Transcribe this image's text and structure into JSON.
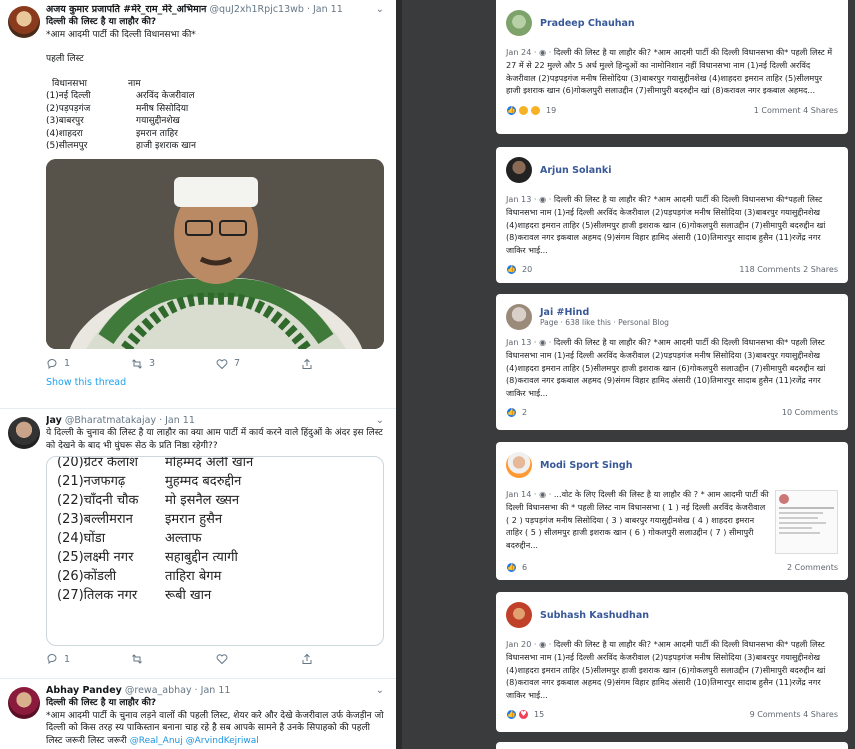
{
  "colors": {
    "twitter_blue": "#1da1f2",
    "fb_link": "#385898",
    "bg": "#3a3b3c"
  },
  "tweets": [
    {
      "name": "अजय कुमार प्रजापति #मेरे_राम_मेरे_अभिमान",
      "handle": "@quJ2xh1Rpjc13wb · Jan 11",
      "title": "दिल्ली की लिस्ट है या लाहौर की?",
      "subtitle": "*आम आदमी पार्टी की दिल्ली विधानसभा की*",
      "list_heading": "पहली लिस्ट",
      "col1_header": "विधानसभा",
      "col2_header": "नाम",
      "rows": [
        {
          "seat": "(1)नई दिल्ली",
          "name": "अरविंद केजरीवाल"
        },
        {
          "seat": "(2)पड़पड़गंज",
          "name": "मनीष सिसोदिया"
        },
        {
          "seat": "(3)बाबरपुर",
          "name": "गयासुद्दीनशेख"
        },
        {
          "seat": "(4)शाहदरा",
          "name": "इमरान ताहिर"
        },
        {
          "seat": "(5)सीलमपुर",
          "name": "हाजी इशराक खान"
        }
      ],
      "replies": "1",
      "retweets": "3",
      "likes": "7",
      "show_thread": "Show this thread"
    },
    {
      "name": "Jay",
      "handle": "@Bharatmatakajay · Jan 11",
      "text": "ये दिल्ली के चुनाव की लिस्ट है या लाहौर का क्या आम पार्टी में कार्य करने वाले हिंदुओं के अंदर इस लिस्ट को देखने के बाद भी घुंघरू सेठ के प्रति निष्ठा रहेगी??",
      "list_rows": [
        {
          "seat": "(20)ग्रेटर कैलाश",
          "name": "मोहम्मद अली खान"
        },
        {
          "seat": "(21)नजफगढ़",
          "name": "मुहम्मद बदरुद्दीन"
        },
        {
          "seat": "(22)चाँदनी चौक",
          "name": "मो इसनैल ख्सन"
        },
        {
          "seat": "(23)बल्लीमरान",
          "name": "इमरान हुसैन"
        },
        {
          "seat": "(24)घोंडा",
          "name": "अल्ताफ"
        },
        {
          "seat": "(25)लक्ष्मी नगर",
          "name": "सहाबुद्दीन त्यागी"
        },
        {
          "seat": "(26)कोंडली",
          "name": "ताहिरा बेगम"
        },
        {
          "seat": "(27)तिलक नगर",
          "name": "रूबी खान"
        }
      ],
      "replies": "1"
    },
    {
      "name": "Abhay Pandey",
      "handle": "@rewa_abhay · Jan 11",
      "text1": "दिल्ली की लिस्ट है या लाहौर की?",
      "text2": "*आम आदमी पार्टी के चुनाव लड़ने वालों की पहली लिस्ट, शेयर करे और देखे केजरीवाल उर्फ केजड़ीन जो दिल्ली को किस तरह स्य पाकिस्तान बनाना चाह रहे है सब आपके सामने है उनके सिपाहको की पहली लिस्ट जरूरी लिस्ट जरूरी",
      "mentions": "@Real_Anuj @ArvindKejriwal"
    }
  ],
  "posts": [
    {
      "name": "Pradeep Chauhan",
      "meta": "Jan 24 · ",
      "text": "दिल्ली की लिस्ट है या लाहौर की? *आम आदमी पार्टी की दिल्ली विधानसभा की* पहली लिस्ट में 27 में से 22 मुल्ले और 5 अर्ध मुल्ले हिन्दुओं का नामोनिशान नहीं विधानसभा नाम (1)नई दिल्ली अरविंद केजरीवाल (2)पड़पड़गंज मनीष सिसोदिया (3)बाबरपुर गयासुद्दीनशेख (4)शाहदरा इमरान ताहिर (5)सीलमपुर हाजी इशराक खान (6)गोकलपुरी सलाउद्दीन (7)सीमापुरी बदरुद्दीन खां (8)करावल नगर इकबाल अहमद...",
      "reactions": "19",
      "right": "1 Comment  4 Shares"
    },
    {
      "name": "Arjun Solanki",
      "meta": "Jan 13 · ",
      "text": "दिल्ली की लिस्ट है या लाहौर की? *आम आदमी पार्टी की दिल्ली विधानसभा की*पहली लिस्ट विधानसभा नाम (1)नई दिल्ली अरविंद केजरीवाल (2)पड़पड़गंज मनीष सिसोदिया (3)बाबरपुर गयासुद्दीनशेख (4)शाहदरा इमरान ताहिर (5)सीलमपुर हाजी इशराक खान (6)गोकलपुरी सलाउद्दीन (7)सीमापुरी बदरुद्दीन खां (8)करावल नगर इकबाल अहमद (9)संगम विहार हामिद अंसारी (10)तिमारपुर सादाब हुसैन (11)रजेंद्र नगर जाकिर भाई...",
      "reactions": "20",
      "right": "118 Comments  2 Shares"
    },
    {
      "name": "Jai #Hind",
      "sub": "Page · 638 like this · Personal Blog",
      "meta": "Jan 13 · ",
      "text": "दिल्ली की लिस्ट है या लाहौर की? *आम आदमी पार्टी की दिल्ली विधानसभा की* पहली लिस्ट विधानसभा नाम (1)नई दिल्ली अरविंद केजरीवाल (2)पड़पड़गंज मनीष सिसोदिया (3)बाबरपुर गयासुद्दीनशेख (4)शाहदरा इमरान ताहिर (5)सीलमपुर हाजी इशराक खान (6)गोकलपुरी सलाउद्दीन (7)सीमापुरी बदरुद्दीन खां (8)करावल नगर इकबाल अहमद (9)संगम विहार हामिद अंसारी (10)तिमारपुर सादाब हुसैन (11)रजेंद्र नगर जाकिर भाई...",
      "reactions": "2",
      "right": "10 Comments"
    },
    {
      "name": "Modi Sport Singh",
      "meta": "Jan 14 · ",
      "text": "...वोट के लिए दिल्ली की लिस्ट है या लाहौर की ? * आम आदमी पार्टी की दिल्ली विधानसभा की * पहली लिस्ट नाम विधानसभा ( 1 ) नई दिल्ली अरविंद केजरीवाल ( 2 ) पड़पड़गंज मनीष सिसोदिया ( 3 ) बाबरपुर गयासुद्दीनशेख ( 4 ) शाहदरा इमरान ताहिर ( 5 ) सीलमपुर हाजी इशराक खान ( 6 ) गोकलपुरी सलाउद्दीन ( 7 ) सीमापुरी बदरुद्दीन...",
      "reactions": "6",
      "right": "2 Comments"
    },
    {
      "name": "Subhash Kashudhan",
      "meta": "Jan 20 · ",
      "text": "दिल्ली की लिस्ट है या लाहौर की? *आम आदमी पार्टी की दिल्ली विधानसभा की* पहली लिस्ट विधानसभा नाम (1)नई दिल्ली अरविंद केजरीवाल (2)पड़पड़गंज मनीष सिसोदिया (3)बाबरपुर गयासुद्दीनशेख (4)शाहदरा इमरान ताहिर (5)सीलमपुर हाजी इशराक खान (6)गोकलपुरी सलाउद्दीन (7)सीमापुरी बदरुद्दीन खां (8)करावल नगर इकबाल अहमद (9)संगम विहार हामिद अंसारी (10)तिमारपुर सादाब हुसैन (11)रजेंद्र नगर जाकिर भाई...",
      "reactions": "15",
      "right": "9 Comments  4 Shares"
    }
  ]
}
